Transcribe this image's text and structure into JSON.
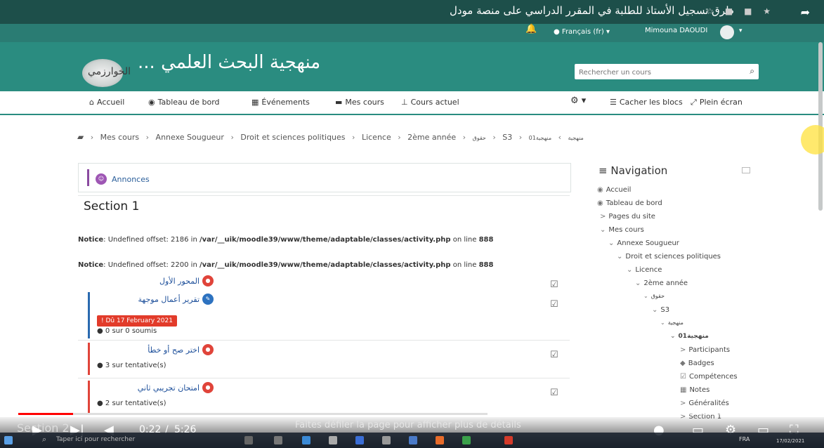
{
  "video": {
    "title": "طرق تسجيل الأستاذ للطلبة في المقرر الدراسي على منصة مودل",
    "time_current": "0:22",
    "time_separator": "/",
    "time_total": "5:26",
    "progress_fraction": 0.069,
    "scroll_hint": "Faites défiler la page pour afficher plus de détails",
    "section_peek": "Section 2"
  },
  "topnav": {
    "language": "Français (fr)",
    "user": "Mimouna DAOUDI"
  },
  "header": {
    "logo_text": "الخوارزمي",
    "site_title": "... منهجية البحث العلمي",
    "search_placeholder": "Rechercher un cours"
  },
  "menu": {
    "items": [
      {
        "label": "Accueil",
        "icon": "home-icon"
      },
      {
        "label": "Tableau de bord",
        "icon": "dashboard-icon"
      },
      {
        "label": "Événements",
        "icon": "calendar-icon"
      },
      {
        "label": "Mes cours",
        "icon": "briefcase-icon"
      },
      {
        "label": "Cours actuel",
        "icon": "sitemap-icon"
      }
    ],
    "hide_blocks": "Cacher les blocs",
    "fullscreen": "Plein écran"
  },
  "breadcrumb": [
    "Mes cours",
    "Annexe Sougueur",
    "Droit et sciences politiques",
    "Licence",
    "2ème année",
    "حقوق",
    "S3",
    "منهجية",
    "منهجية01"
  ],
  "main": {
    "announcements": "Annonces",
    "section_title": "Section 1",
    "notices": [
      {
        "label": "Notice",
        "text": ": Undefined offset: 2186 in ",
        "path": "/var/__uik/moodle39/www/theme/adaptable/classes/activity.php",
        "on": " on line ",
        "line": "888"
      },
      {
        "label": "Notice",
        "text": ": Undefined offset: 2200 in ",
        "path": "/var/__uik/moodle39/www/theme/adaptable/classes/activity.php",
        "on": " on line ",
        "line": "888"
      }
    ],
    "activities": [
      {
        "name": "المحور الأول",
        "meta": ""
      },
      {
        "name": "تقرير أعمال موجهة",
        "due": "Dû 17 February 2021",
        "meta": "0 sur 0 soumis"
      },
      {
        "name": "اختر صح أو خطأ",
        "meta": "3 sur tentative(s)"
      },
      {
        "name": "امتحان تجريبي ثاني",
        "meta": "2 sur tentative(s)"
      }
    ]
  },
  "navigation": {
    "title": "Navigation",
    "items": [
      {
        "label": "Accueil",
        "pre": ""
      },
      {
        "label": "Tableau de bord",
        "pre": ""
      },
      {
        "label": "Pages du site",
        "pre": ">"
      },
      {
        "label": "Mes cours",
        "pre": "⌄"
      },
      {
        "label": "Annexe Sougueur",
        "pre": "⌄"
      },
      {
        "label": "Droit et sciences politiques",
        "pre": "⌄"
      },
      {
        "label": "Licence",
        "pre": "⌄"
      },
      {
        "label": "2ème année",
        "pre": "⌄"
      },
      {
        "label": "حقوق",
        "pre": "⌄"
      },
      {
        "label": "S3",
        "pre": "⌄"
      },
      {
        "label": "منهجية",
        "pre": "⌄"
      },
      {
        "label": "منهجية01",
        "pre": "⌄"
      },
      {
        "label": "Participants",
        "pre": ">"
      },
      {
        "label": "Badges",
        "pre": ""
      },
      {
        "label": "Compétences",
        "pre": ""
      },
      {
        "label": "Notes",
        "pre": ""
      },
      {
        "label": "Généralités",
        "pre": ">"
      },
      {
        "label": "Section 1",
        "pre": ">"
      }
    ]
  },
  "taskbar": {
    "search_placeholder": "Taper ici pour rechercher",
    "language": "FRA",
    "date": "17/02/2021"
  }
}
